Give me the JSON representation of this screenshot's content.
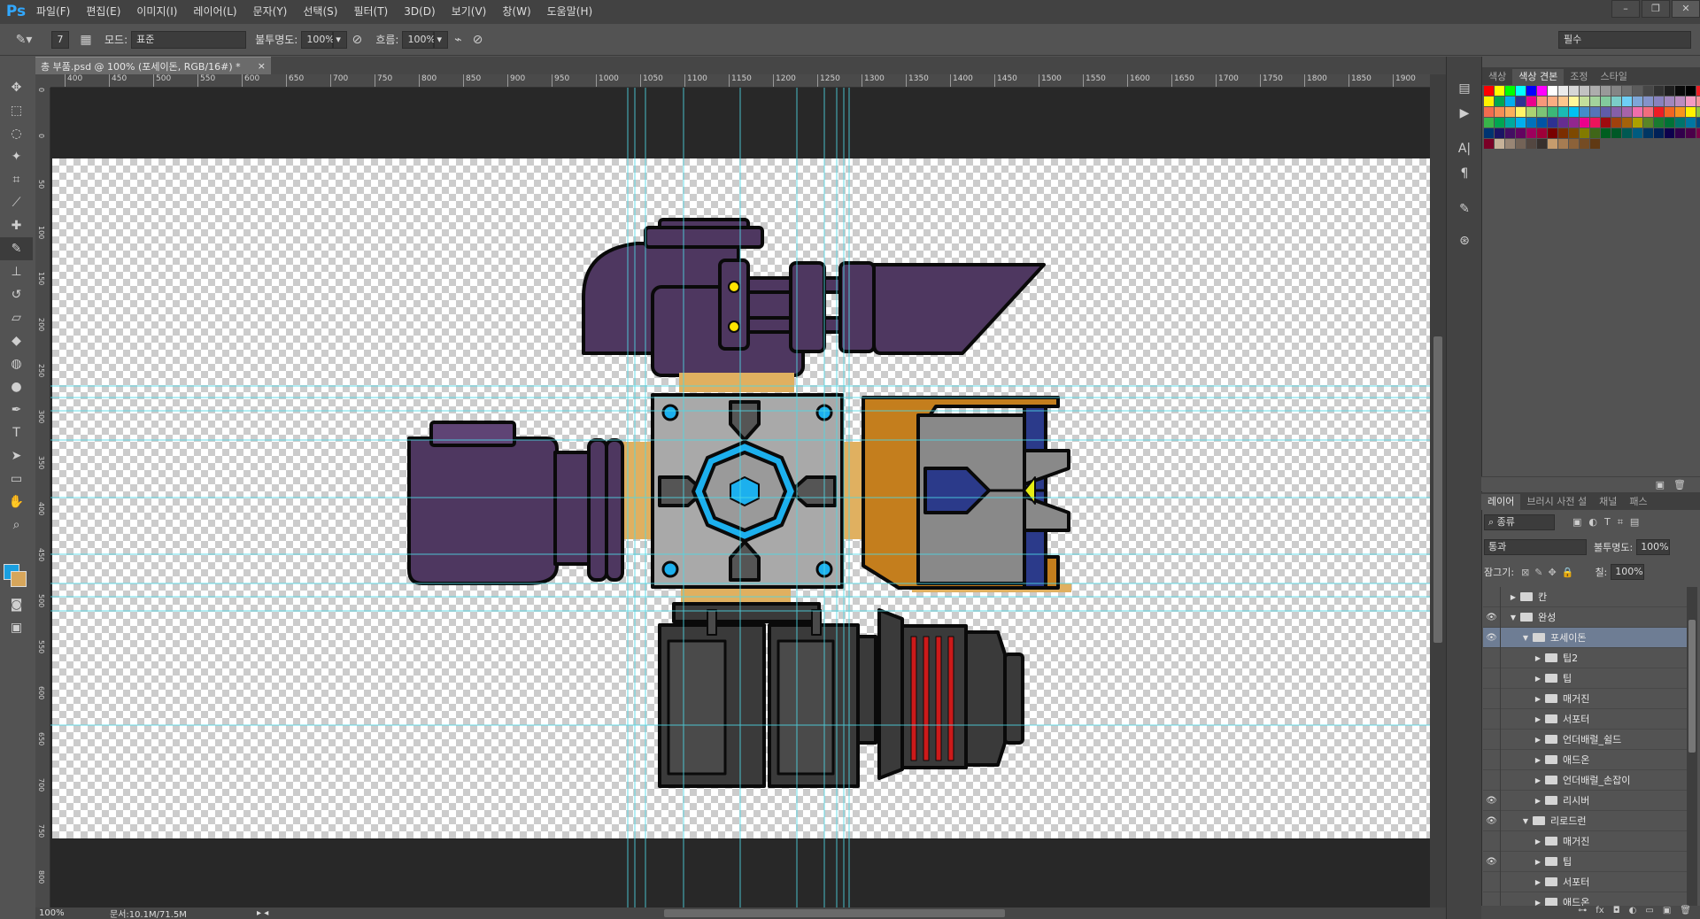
{
  "app": {
    "logo": "Ps",
    "menu": [
      "파일(F)",
      "편집(E)",
      "이미지(I)",
      "레이어(L)",
      "문자(Y)",
      "선택(S)",
      "필터(T)",
      "3D(D)",
      "보기(V)",
      "창(W)",
      "도움말(H)"
    ]
  },
  "window": {
    "minimize": "–",
    "restore": "❐",
    "close": "✕"
  },
  "options": {
    "brush_size": "7",
    "mode_label": "모드:",
    "mode_value": "표준",
    "opacity_label": "불투명도:",
    "opacity_value": "100%",
    "flow_label": "흐름:",
    "flow_value": "100%",
    "workspace": "필수"
  },
  "document": {
    "tab_title": "총 부품.psd @ 100% (포세이돈, RGB/16#) *",
    "close": "×",
    "zoom": "100%",
    "doc_info": "문서:10.1M/71.5M"
  },
  "ruler_top": [
    "400",
    "450",
    "500",
    "550",
    "600",
    "650",
    "700",
    "750",
    "800",
    "850",
    "900",
    "950",
    "1000",
    "1050",
    "1100",
    "1150",
    "1200",
    "1250",
    "1300",
    "1350",
    "1400",
    "1450",
    "1500",
    "1550",
    "1600",
    "1650",
    "1700",
    "1750",
    "1800",
    "1850",
    "1900"
  ],
  "ruler_left": [
    "0",
    "0",
    "50",
    "100",
    "150",
    "200",
    "250",
    "300",
    "350",
    "400",
    "450",
    "500",
    "550",
    "600",
    "650",
    "700",
    "750",
    "800"
  ],
  "panels": {
    "color_tabs": [
      "색상",
      "색상 견본",
      "조정",
      "스타일"
    ],
    "color_active": 1,
    "layer_tabs": [
      "레이어",
      "브러시 사전 설",
      "채널",
      "패스"
    ]
  },
  "swatch_colors": [
    "#ff0000",
    "#ffff00",
    "#00ff00",
    "#00ffff",
    "#0000ff",
    "#ff00ff",
    "#ffffff",
    "#ebebeb",
    "#d6d6d6",
    "#c2c2c2",
    "#adadad",
    "#999999",
    "#858585",
    "#707070",
    "#5c5c5c",
    "#474747",
    "#333333",
    "#1f1f1f",
    "#0a0a0a",
    "#000000",
    "#ee1d24",
    "#fff200",
    "#00a651",
    "#00aeef",
    "#2e3192",
    "#ec008c",
    "#f7977a",
    "#fbad82",
    "#fdc68c",
    "#fff79a",
    "#c4df9b",
    "#a3d39c",
    "#82ca9d",
    "#7bcdc8",
    "#6ecff6",
    "#7ea7d8",
    "#8493ca",
    "#8882be",
    "#a187be",
    "#bc8cbf",
    "#f49bc1",
    "#f5989d",
    "#f26c4f",
    "#f68e56",
    "#fbaf5c",
    "#fff467",
    "#acd372",
    "#7cc576",
    "#3bb878",
    "#1abbb4",
    "#00bff3",
    "#438cca",
    "#5574b9",
    "#605ca8",
    "#855fa8",
    "#a763a9",
    "#f06eaa",
    "#f26d7d",
    "#ed1c24",
    "#f26522",
    "#f7941d",
    "#fff200",
    "#8dc63f",
    "#39b54a",
    "#00a651",
    "#00a99d",
    "#00aeef",
    "#0072bc",
    "#0054a5",
    "#2e3192",
    "#662d91",
    "#92278f",
    "#ec008c",
    "#ed145b",
    "#9e0b0f",
    "#a0410d",
    "#a3620a",
    "#aba000",
    "#598527",
    "#197b30",
    "#007236",
    "#00746b",
    "#0076a3",
    "#004a80",
    "#003471",
    "#1b1464",
    "#440e62",
    "#630460",
    "#9e005d",
    "#9e0039",
    "#790000",
    "#7b2e00",
    "#7d4900",
    "#827b00",
    "#406618",
    "#005e20",
    "#005826",
    "#005952",
    "#005b7f",
    "#003663",
    "#002157",
    "#0d004c",
    "#32004b",
    "#4b0049",
    "#7b0046",
    "#7a0026",
    "#c7b299",
    "#998675",
    "#736357",
    "#534741",
    "#37302d",
    "#c69c6d",
    "#a67c52",
    "#8c6239",
    "#754c24",
    "#603913"
  ],
  "layers": [
    {
      "name": "칸",
      "eye": false,
      "open": false,
      "indent": 0
    },
    {
      "name": "완성",
      "eye": true,
      "open": true,
      "indent": 0
    },
    {
      "name": "포세이돈",
      "eye": true,
      "open": true,
      "indent": 1,
      "selected": true
    },
    {
      "name": "팁2",
      "eye": false,
      "open": false,
      "indent": 2
    },
    {
      "name": "팁",
      "eye": false,
      "open": false,
      "indent": 2
    },
    {
      "name": "매거진",
      "eye": false,
      "open": false,
      "indent": 2
    },
    {
      "name": "서포터",
      "eye": false,
      "open": false,
      "indent": 2
    },
    {
      "name": "언더배럴_쉴드",
      "eye": false,
      "open": false,
      "indent": 2
    },
    {
      "name": "애드온",
      "eye": false,
      "open": false,
      "indent": 2
    },
    {
      "name": "언더배럴_손잡이",
      "eye": false,
      "open": false,
      "indent": 2
    },
    {
      "name": "리시버",
      "eye": true,
      "open": false,
      "indent": 2
    },
    {
      "name": "리로드런",
      "eye": true,
      "open": true,
      "indent": 1
    },
    {
      "name": "매거진",
      "eye": false,
      "open": false,
      "indent": 2
    },
    {
      "name": "팁",
      "eye": true,
      "open": false,
      "indent": 2
    },
    {
      "name": "서포터",
      "eye": false,
      "open": false,
      "indent": 2
    },
    {
      "name": "애드온",
      "eye": false,
      "open": false,
      "indent": 2
    }
  ],
  "layer_controls": {
    "filter": "종류",
    "blend": "통과",
    "opacity_label": "불투명도:",
    "opacity_value": "100%",
    "lock_label": "잠그기:",
    "fill_label": "칠:",
    "fill_value": "100%"
  },
  "colors": {
    "fg": "#1a9fe0",
    "bg": "#d7a65b",
    "guide": "#4dd8e6",
    "purple": "#4e3760",
    "gray": "#9a9a9a",
    "orange": "#e0b060",
    "dark": "#3a3a3a",
    "cyan": "#1cb0ee"
  }
}
